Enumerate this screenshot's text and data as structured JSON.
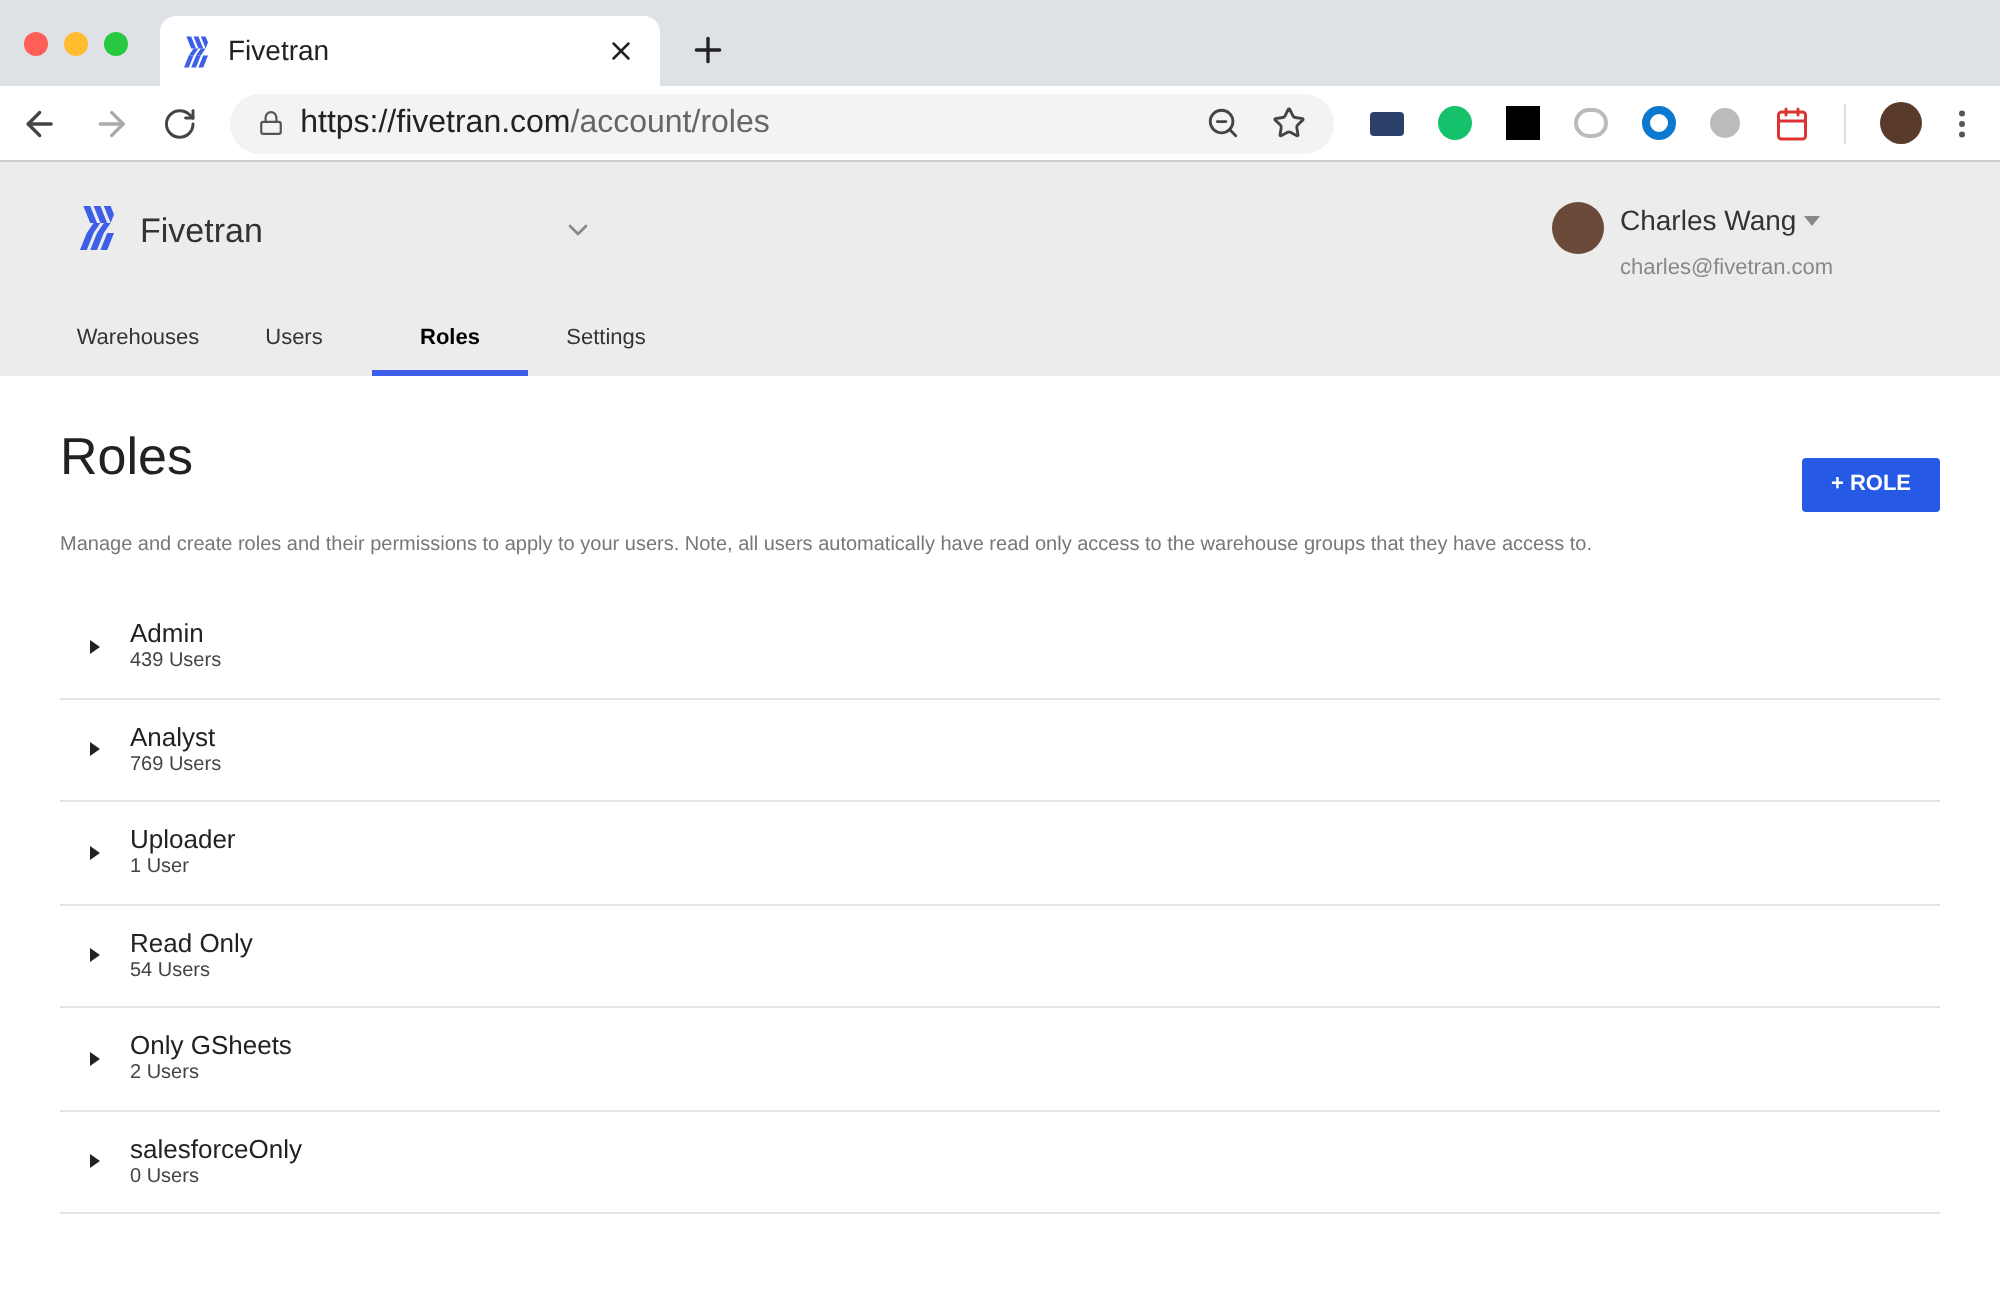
{
  "browser": {
    "tab": {
      "title": "Fivetran",
      "selected": true
    },
    "url_host": "https://fivetran.com",
    "url_path": "/account/roles"
  },
  "header": {
    "brand": "Fivetran",
    "user": {
      "name": "Charles Wang",
      "email": "charles@fivetran.com"
    }
  },
  "tabs": [
    {
      "label": "Warehouses",
      "selected": false
    },
    {
      "label": "Users",
      "selected": false
    },
    {
      "label": "Roles",
      "selected": true
    },
    {
      "label": "Settings",
      "selected": false
    }
  ],
  "page": {
    "title": "Roles",
    "add_button": "+ ROLE",
    "description": "Manage and create roles and their permissions to apply to your users. Note, all users automatically have read only access to the warehouse groups that they have access to."
  },
  "roles": [
    {
      "name": "Admin",
      "count": "439 Users",
      "expanded": false
    },
    {
      "name": "Analyst",
      "count": "769 Users",
      "expanded": false
    },
    {
      "name": "Uploader",
      "count": "1 User",
      "expanded": false
    },
    {
      "name": "Read Only",
      "count": "54 Users",
      "expanded": false
    },
    {
      "name": "Only GSheets",
      "count": "2 Users",
      "expanded": false
    },
    {
      "name": "salesforceOnly",
      "count": "0 Users",
      "expanded": false
    }
  ]
}
